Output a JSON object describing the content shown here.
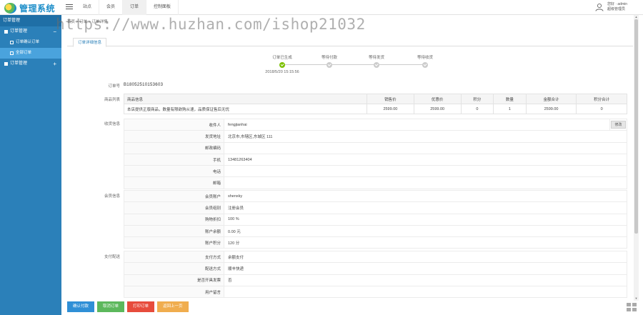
{
  "app": {
    "title": "管理系统"
  },
  "topnav": [
    "站点",
    "会员",
    "订单",
    "控制面板"
  ],
  "topnav_active": 2,
  "user": {
    "line1": "您好 · admin",
    "line2": "超级管理员"
  },
  "sidebar": {
    "title": "订单管理",
    "groups": [
      {
        "label": "订单管理",
        "toggle": "−",
        "items": [
          {
            "label": "订单确认订单",
            "active": false
          },
          {
            "label": "全部订单",
            "active": true
          }
        ]
      },
      {
        "label": "订单管理",
        "toggle": "+"
      }
    ]
  },
  "breadcrumb": "首页 > 订单 > 订单详情",
  "watermark": "https://www.huzhan.com/ishop21032",
  "tab": {
    "label": "订单详细信息"
  },
  "progress": {
    "steps": [
      {
        "label": "订单已生成",
        "done": true,
        "time": "2018/5/20 15:15:56"
      },
      {
        "label": "等待付款",
        "done": false
      },
      {
        "label": "等待发货",
        "done": false
      },
      {
        "label": "等待收货",
        "done": false
      }
    ]
  },
  "labels": {
    "order_no": "订单号",
    "goods": "商品列表",
    "receiver": "收货信息",
    "member": "会员信息",
    "payment": "支付配送"
  },
  "order_no": "B18052510153603",
  "goods": {
    "headers": [
      "商品信息",
      "销售价",
      "优惠价",
      "积分",
      "数量",
      "金额合计",
      "积分合计"
    ],
    "rows": [
      [
        "本店提供正版商品，数量有限欲购从速，品质保证售后无忧",
        "2599.00",
        "2599.00",
        "0",
        "1",
        "2599.00",
        "0"
      ]
    ]
  },
  "receiver": {
    "edit_label": "修改",
    "rows": [
      {
        "k": "收件人",
        "v": "fengjianhai"
      },
      {
        "k": "发货地址",
        "v": "北京市,市辖区,东城区 111"
      },
      {
        "k": "邮政编码",
        "v": ""
      },
      {
        "k": "手机",
        "v": "13481263404"
      },
      {
        "k": "电话",
        "v": ""
      },
      {
        "k": "邮箱",
        "v": ""
      }
    ]
  },
  "member": {
    "rows": [
      {
        "k": "会员账户",
        "v": "shenxky"
      },
      {
        "k": "会员组别",
        "v": "注册会员"
      },
      {
        "k": "购物折扣",
        "v": "100 %"
      },
      {
        "k": "账户余额",
        "v": "0.00 元"
      },
      {
        "k": "账户积分",
        "v": "120 分"
      }
    ]
  },
  "payment": {
    "rows": [
      {
        "k": "支付方式",
        "v": "余额支付"
      },
      {
        "k": "配送方式",
        "v": "顺丰快递"
      },
      {
        "k": "是否开具发票",
        "v": "否"
      },
      {
        "k": "用户留言",
        "v": ""
      }
    ]
  },
  "actions": [
    {
      "label": "确认付款",
      "color": "blue"
    },
    {
      "label": "取消订单",
      "color": "green"
    },
    {
      "label": "打印订单",
      "color": "red"
    },
    {
      "label": "返回上一页",
      "color": "orange"
    }
  ]
}
